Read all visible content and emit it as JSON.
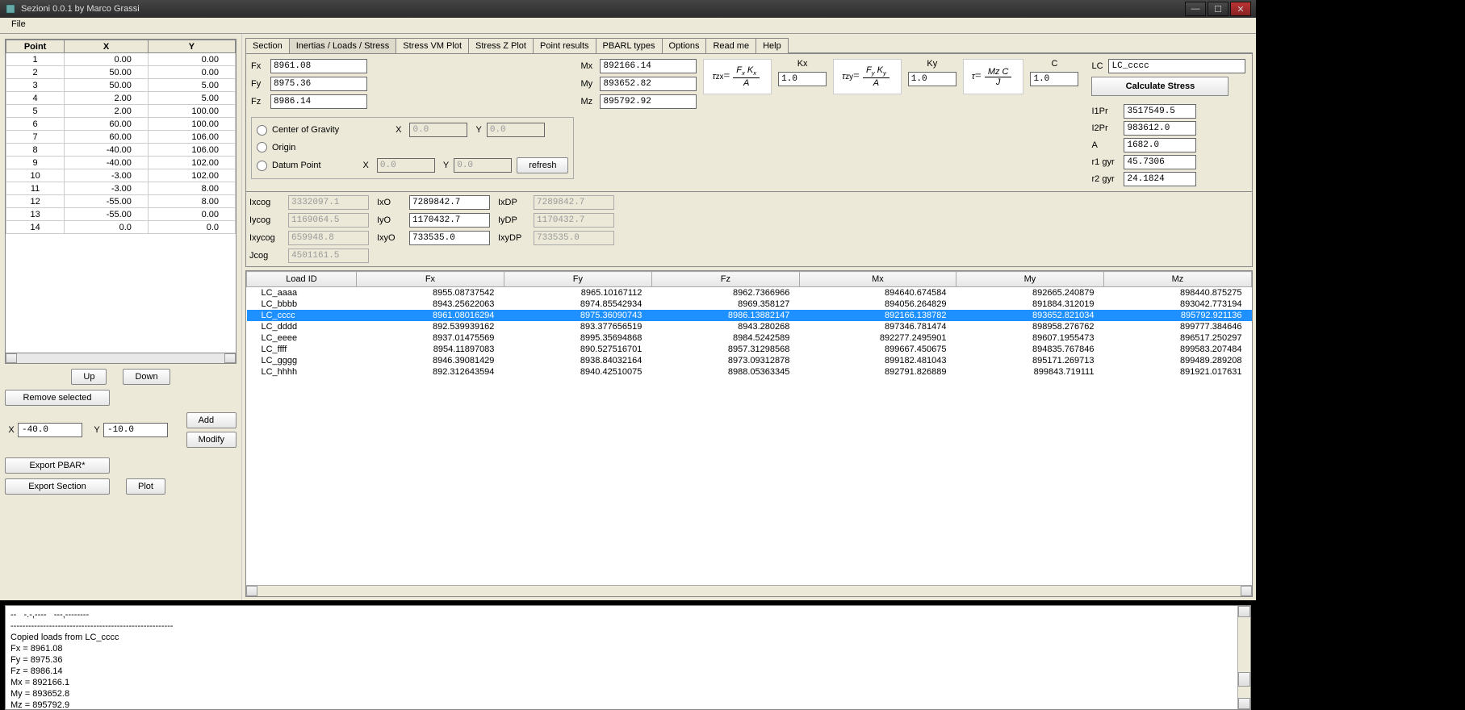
{
  "window": {
    "title": "Sezioni 0.0.1 by Marco Grassi"
  },
  "menubar": {
    "file": "File"
  },
  "points": {
    "headers": [
      "Point",
      "X",
      "Y"
    ],
    "rows": [
      [
        "1",
        "0.00",
        "0.00"
      ],
      [
        "2",
        "50.00",
        "0.00"
      ],
      [
        "3",
        "50.00",
        "5.00"
      ],
      [
        "4",
        "2.00",
        "5.00"
      ],
      [
        "5",
        "2.00",
        "100.00"
      ],
      [
        "6",
        "60.00",
        "100.00"
      ],
      [
        "7",
        "60.00",
        "106.00"
      ],
      [
        "8",
        "-40.00",
        "106.00"
      ],
      [
        "9",
        "-40.00",
        "102.00"
      ],
      [
        "10",
        "-3.00",
        "102.00"
      ],
      [
        "11",
        "-3.00",
        "8.00"
      ],
      [
        "12",
        "-55.00",
        "8.00"
      ],
      [
        "13",
        "-55.00",
        "0.00"
      ],
      [
        "14",
        "0.0",
        "0.0"
      ]
    ]
  },
  "left_buttons": {
    "up": "Up",
    "down": "Down",
    "remove": "Remove selected",
    "add": "Add",
    "modify": "Modify",
    "export_pbar": "Export PBAR*",
    "export_section": "Export Section",
    "plot": "Plot"
  },
  "coord": {
    "x_label": "X",
    "x_val": "-40.0",
    "y_label": "Y",
    "y_val": "-10.0"
  },
  "tabs": [
    "Section",
    "Inertias / Loads / Stress",
    "Stress VM Plot",
    "Stress Z Plot",
    "Point results",
    "PBARL types",
    "Options",
    "Read me",
    "Help"
  ],
  "forces": {
    "fx_l": "Fx",
    "fx": "8961.08",
    "fy_l": "Fy",
    "fy": "8975.36",
    "fz_l": "Fz",
    "fz": "8986.14",
    "mx_l": "Mx",
    "mx": "892166.14",
    "my_l": "My",
    "my": "893652.82",
    "mz_l": "Mz",
    "mz": "895792.92"
  },
  "ref": {
    "cog": "Center of Gravity",
    "origin": "Origin",
    "datum": "Datum Point",
    "x_l": "X",
    "y_l": "Y",
    "x": "0.0",
    "y": "0.0",
    "x2": "0.0",
    "y2": "0.0",
    "refresh": "refresh"
  },
  "kvals": {
    "kx_l": "Kx",
    "kx": "1.0",
    "ky_l": "Ky",
    "ky": "1.0",
    "c_l": "C",
    "c": "1.0"
  },
  "cog_props": {
    "ixcog_l": "Ixcog",
    "ixcog": "3332097.1",
    "iycog_l": "Iycog",
    "iycog": "1169064.5",
    "ixycog_l": "Ixycog",
    "ixycog": "659948.8",
    "jcog_l": "Jcog",
    "jcog": "4501161.5"
  },
  "origin_props": {
    "ixo_l": "IxO",
    "ixo": "7289842.7",
    "iyo_l": "IyO",
    "iyo": "1170432.7",
    "ixyo_l": "IxyO",
    "ixyo": "733535.0"
  },
  "dp_props": {
    "ixdp_l": "IxDP",
    "ixdp": "7289842.7",
    "iydp_l": "IyDP",
    "iydp": "1170432.7",
    "ixydp_l": "IxyDP",
    "ixydp": "733535.0"
  },
  "stats": {
    "i1pr_l": "I1Pr",
    "i1pr": "3517549.5",
    "i2pr_l": "I2Pr",
    "i2pr": "983612.0",
    "a_l": "A",
    "a": "1682.0",
    "r1_l": "r1 gyr",
    "r1": "45.7306",
    "r2_l": "r2 gyr",
    "r2": "24.1824"
  },
  "lc": {
    "label": "LC",
    "value": "LC_cccc",
    "calc": "Calculate Stress"
  },
  "load_headers": [
    "Load ID",
    "Fx",
    "Fy",
    "Fz",
    "Mx",
    "My",
    "Mz"
  ],
  "loads": [
    {
      "id": "LC_aaaa",
      "fx": "8955.08737542",
      "fy": "8965.10167112",
      "fz": "8962.7366966",
      "mx": "894640.674584",
      "my": "892665.240879",
      "mz": "898440.875275"
    },
    {
      "id": "LC_bbbb",
      "fx": "8943.25622063",
      "fy": "8974.85542934",
      "fz": "8969.358127",
      "mx": "894056.264829",
      "my": "891884.312019",
      "mz": "893042.773194"
    },
    {
      "id": "LC_cccc",
      "fx": "8961.08016294",
      "fy": "8975.36090743",
      "fz": "8986.13882147",
      "mx": "892166.138782",
      "my": "893652.821034",
      "mz": "895792.921136",
      "sel": true
    },
    {
      "id": "LC_dddd",
      "fx": "892.539939162",
      "fy": "893.377656519",
      "fz": "8943.280268",
      "mx": "897346.781474",
      "my": "898958.276762",
      "mz": "899777.384646"
    },
    {
      "id": "LC_eeee",
      "fx": "8937.01475569",
      "fy": "8995.35694868",
      "fz": "8984.5242589",
      "mx": "892277.2495901",
      "my": "89607.1955473",
      "mz": "896517.250297"
    },
    {
      "id": "LC_ffff",
      "fx": "8954.11897083",
      "fy": "890.527516701",
      "fz": "8957.31298568",
      "mx": "899667.450675",
      "my": "894835.767846",
      "mz": "899583.207484"
    },
    {
      "id": "LC_gggg",
      "fx": "8946.39081429",
      "fy": "8938.84032164",
      "fz": "8973.09312878",
      "mx": "899182.481043",
      "my": "895171.269713",
      "mz": "899489.289208"
    },
    {
      "id": "LC_hhhh",
      "fx": "892.312643594",
      "fy": "8940.42510075",
      "fz": "8988.05363345",
      "mx": "892791.826889",
      "my": "899843.719111",
      "mz": "891921.017631"
    }
  ],
  "log": "--   -.-,----   ---,--------\n-------------------------------------------------------\nCopied loads from LC_cccc\nFx = 8961.08\nFy = 8975.36\nFz = 8986.14\nMx = 892166.1\nMy = 893652.8\nMz = 895792.9"
}
